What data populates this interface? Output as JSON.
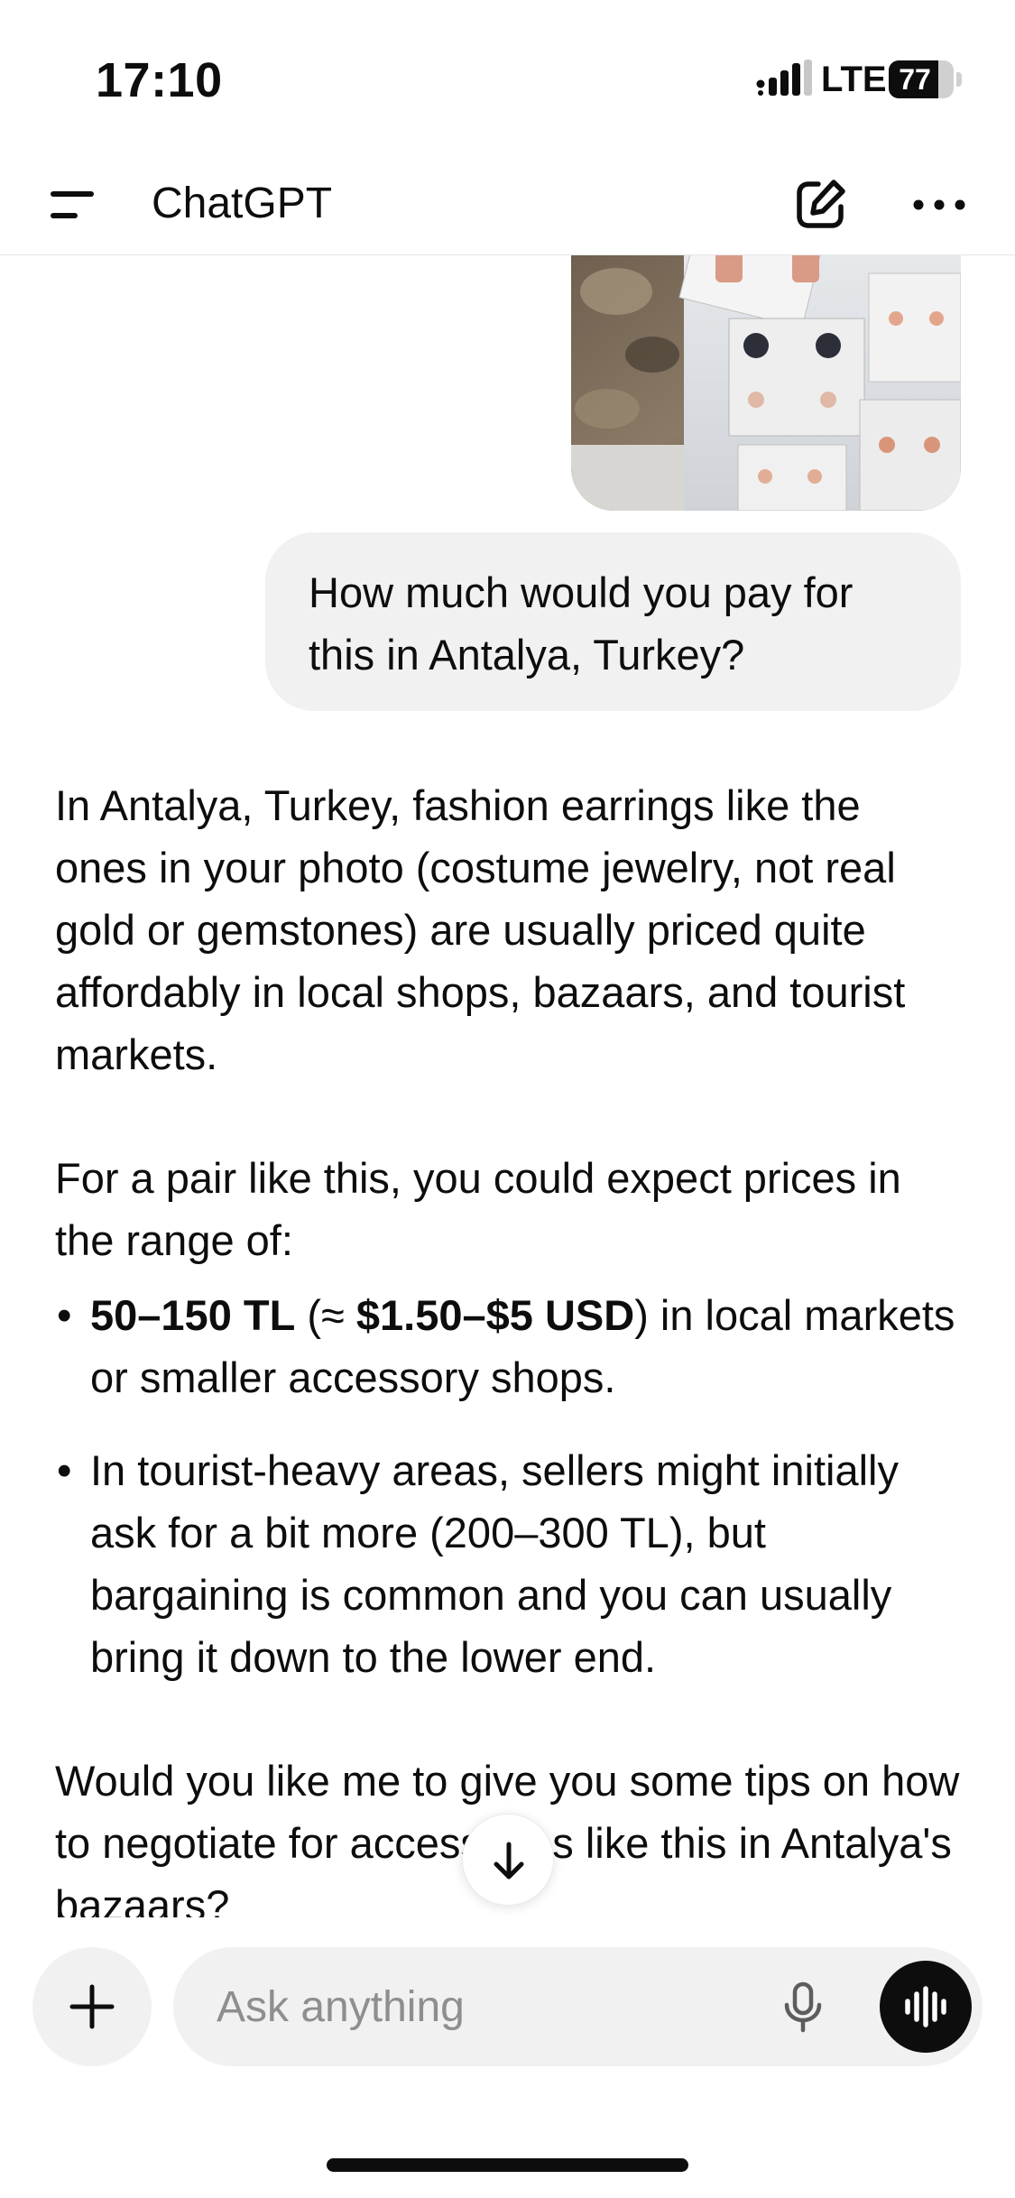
{
  "status_bar": {
    "time": "17:10",
    "network": "LTE",
    "battery": "77",
    "battery_level_percent": 77
  },
  "header": {
    "title": "ChatGPT",
    "menu_icon": "hamburger-menu-icon",
    "new_chat_icon": "new-chat-edit-icon",
    "more_icon": "more-ellipsis-icon"
  },
  "conversation": {
    "user_image_icon": "earrings-photo",
    "user_message": "How much would you pay for this in Antalya, Turkey?",
    "assistant": {
      "para1": "In Antalya, Turkey, fashion earrings like the ones in your photo (costume jewelry, not real gold or gemstones) are usually priced quite affordably in local shops, bazaars, and tourist markets.",
      "para2": "For a pair like this, you could expect prices in the range of:",
      "bullets": {
        "b1_bold1": "50–150 TL",
        "b1_mid": " (≈ ",
        "b1_bold2": "$1.50–$5 USD",
        "b1_rest": ") in local markets or smaller accessory shops.",
        "b2": "In tourist-heavy areas, sellers might initially ask for a bit more (200–300 TL), but bargaining is common and you can usually bring it down to the lower end."
      },
      "para3": "Would you like me to give you some tips on how to negotiate for accessories like this in Antalya's bazaars?"
    },
    "bullet_char": "•"
  },
  "composer": {
    "placeholder": "Ask anything",
    "plus_icon": "plus-icon",
    "mic_icon": "microphone-icon",
    "voice_icon": "voice-mode-icon"
  },
  "colors": {
    "text": "#0d0d0d",
    "bubble": "#f1f1f1",
    "placeholder": "#8e8e8e",
    "divider": "#e6e6e6"
  }
}
